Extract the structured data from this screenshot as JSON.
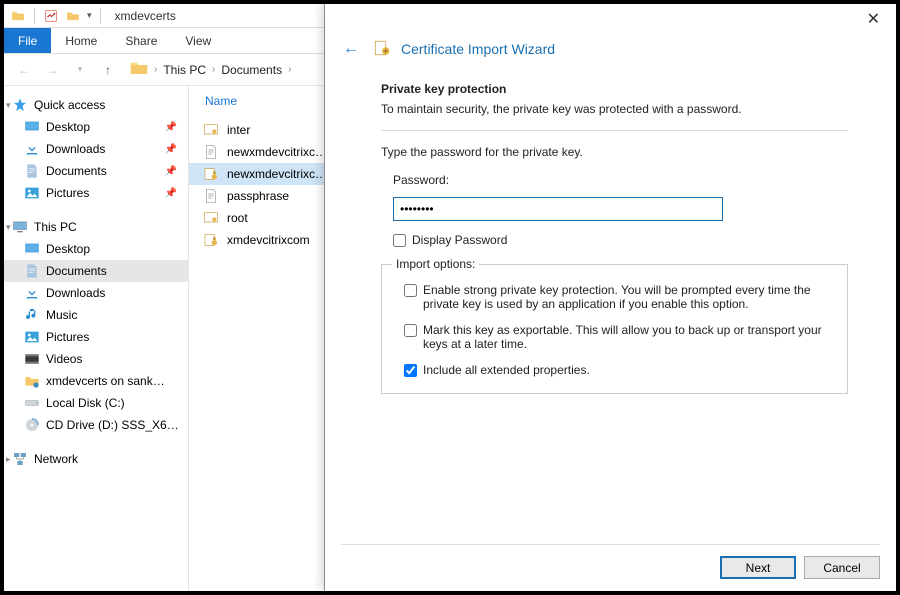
{
  "titlebar": {
    "title": "xmdevcerts"
  },
  "ribbon": {
    "file": "File",
    "home": "Home",
    "share": "Share",
    "view": "View"
  },
  "address": {
    "root": "This PC",
    "folder": "Documents"
  },
  "navpane": {
    "quick_access": "Quick access",
    "qa": {
      "desktop": "Desktop",
      "downloads": "Downloads",
      "documents": "Documents",
      "pictures": "Pictures"
    },
    "this_pc": "This PC",
    "pc": {
      "desktop": "Desktop",
      "documents": "Documents",
      "downloads": "Downloads",
      "music": "Music",
      "pictures": "Pictures",
      "videos": "Videos",
      "share": "xmdevcerts on sank…",
      "localdisk": "Local Disk (C:)",
      "cddrive": "CD Drive (D:) SSS_X6…"
    },
    "network": "Network"
  },
  "filecol": "Name",
  "files": {
    "0": "inter",
    "1": "newxmdevcitrixc…",
    "2": "newxmdevcitrixc…",
    "3": "passphrase",
    "4": "root",
    "5": "xmdevcitrixcom"
  },
  "wizard": {
    "title": "Certificate Import Wizard",
    "heading": "Private key protection",
    "desc": "To maintain security, the private key was protected with a password.",
    "prompt": "Type the password for the private key.",
    "password_label": "Password:",
    "password_value": "••••••••",
    "display_pw": "Display Password",
    "options_legend": "Import options:",
    "opt_strong": "Enable strong private key protection. You will be prompted every time the private key is used by an application if you enable this option.",
    "opt_export": "Mark this key as exportable. This will allow you to back up or transport your keys at a later time.",
    "opt_ext": "Include all extended properties.",
    "next": "Next",
    "cancel": "Cancel"
  }
}
